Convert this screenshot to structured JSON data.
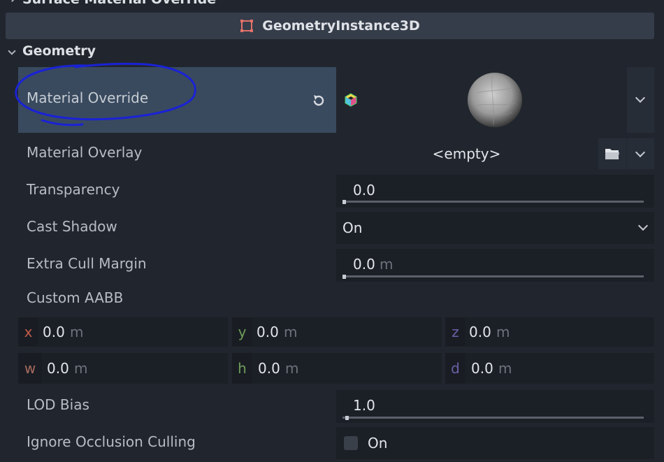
{
  "previous_section": {
    "label": "Surface Material Override"
  },
  "class_bar": {
    "title": "GeometryInstance3D"
  },
  "section": {
    "label": "Geometry"
  },
  "properties": {
    "material_override": {
      "label": "Material Override"
    },
    "material_overlay": {
      "label": "Material Overlay",
      "value": "<empty>"
    },
    "transparency": {
      "label": "Transparency",
      "value": "0.0",
      "slider_fraction": 0.0
    },
    "cast_shadow": {
      "label": "Cast Shadow",
      "value": "On"
    },
    "extra_cull_margin": {
      "label": "Extra Cull Margin",
      "value": "0.0",
      "unit": "m",
      "slider_fraction": 0.0
    },
    "custom_aabb": {
      "label": "Custom AABB",
      "fields": [
        {
          "axis": "x",
          "value": "0.0",
          "unit": "m",
          "color": "#c25a4a"
        },
        {
          "axis": "y",
          "value": "0.0",
          "unit": "m",
          "color": "#6f9c5b"
        },
        {
          "axis": "z",
          "value": "0.0",
          "unit": "m",
          "color": "#6c5fa8"
        },
        {
          "axis": "w",
          "value": "0.0",
          "unit": "m",
          "color": "#a86a5f"
        },
        {
          "axis": "h",
          "value": "0.0",
          "unit": "m",
          "color": "#6f9c5b"
        },
        {
          "axis": "d",
          "value": "0.0",
          "unit": "m",
          "color": "#6c5fa8"
        }
      ]
    },
    "lod_bias": {
      "label": "LOD Bias",
      "value": "1.0",
      "slider_fraction": 0.01
    },
    "ignore_occlusion_culling": {
      "label": "Ignore Occlusion Culling",
      "value": "On",
      "checked": false
    }
  },
  "icons": {
    "revert": "revert-icon",
    "material": "material-cube-icon",
    "folder": "folder-icon",
    "dropdown": "chevron-down-icon"
  },
  "colors": {
    "selected_row": "#394a5f",
    "annotation": "#1a22d6",
    "node_icon": "#e0716a"
  }
}
